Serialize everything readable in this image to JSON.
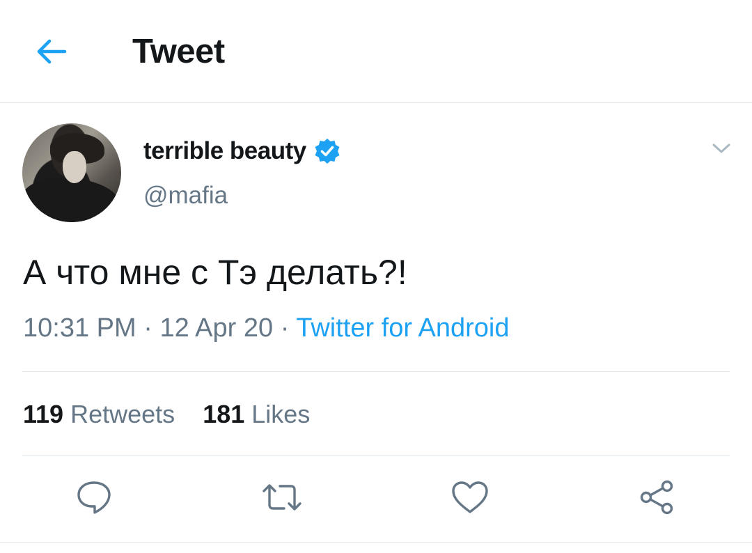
{
  "header": {
    "title": "Tweet",
    "back_icon": "arrow-left-icon"
  },
  "colors": {
    "accent": "#1da1f2",
    "text": "#14171a",
    "secondary": "#657786",
    "divider": "#e1e8ed"
  },
  "tweet": {
    "display_name": "terrible beauty",
    "handle": "@mafia",
    "verified": true,
    "text": "А что мне с Тэ делать?!",
    "time": "10:31 PM",
    "date": "12 Apr 20",
    "source": "Twitter for Android",
    "separator": "·"
  },
  "stats": {
    "retweets_count": "119",
    "retweets_label": "Retweets",
    "likes_count": "181",
    "likes_label": "Likes"
  },
  "actions": [
    "reply-icon",
    "retweet-icon",
    "like-icon",
    "share-icon"
  ]
}
